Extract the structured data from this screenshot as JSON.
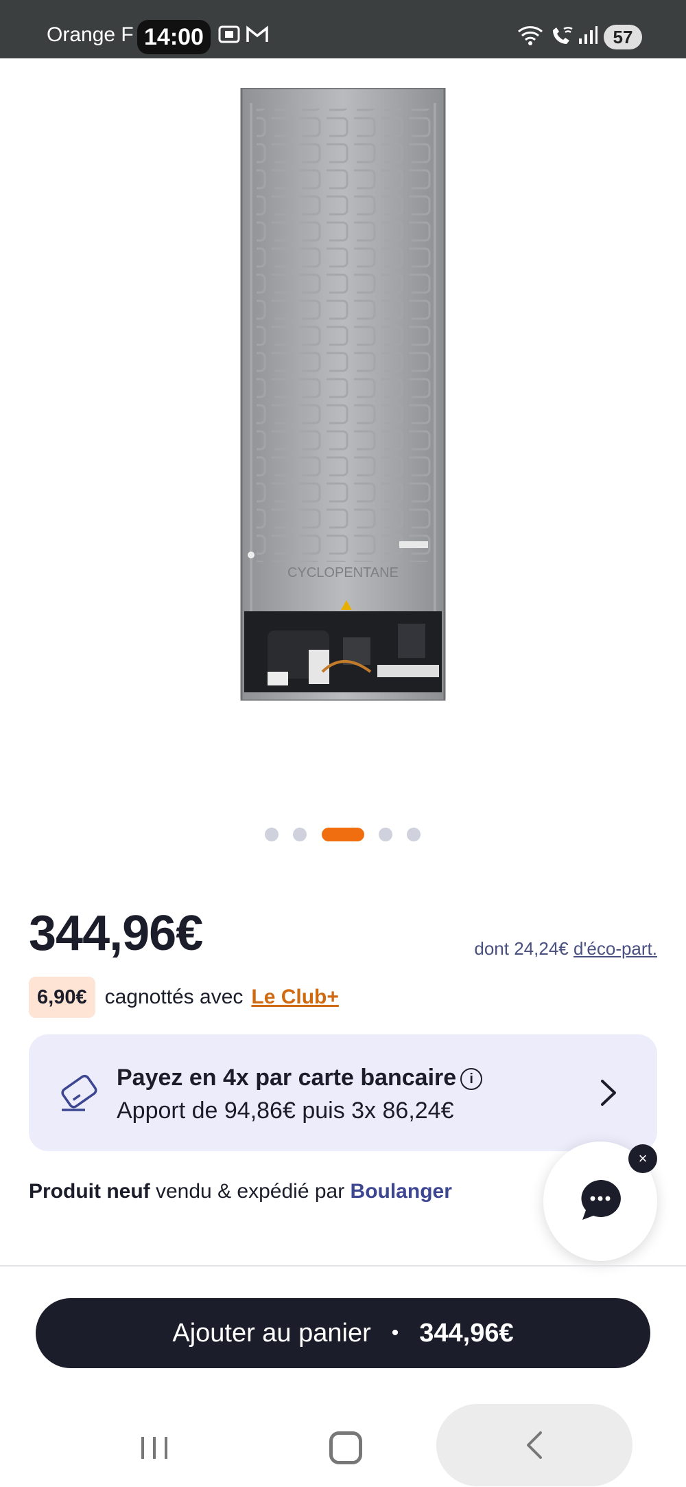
{
  "status_bar": {
    "carrier": "Orange F",
    "time": "14:00",
    "battery": "57"
  },
  "gallery": {
    "dots_count": 5,
    "active_index": 2
  },
  "product": {
    "price": "344,96€",
    "eco_prefix": "dont 24,24€ ",
    "eco_link": "d'éco-part."
  },
  "cashback": {
    "amount": "6,90€",
    "text": "cagnottés avec",
    "club_link": "Le Club+"
  },
  "payment": {
    "title": "Payez en 4x par carte bancaire",
    "info_glyph": "i",
    "detail": "Apport de 94,86€ puis 3x 86,24€"
  },
  "seller": {
    "condition": "Produit neuf",
    "text": " vendu & expédié par ",
    "brand": "Boulanger"
  },
  "chat": {
    "close_glyph": "×"
  },
  "cart_button": {
    "label": "Ajouter au panier",
    "separator": "•",
    "amount": "344,96€"
  },
  "colors": {
    "accent": "#f06e0f",
    "dark": "#1b1d2a",
    "payment_bg": "#ececfb",
    "cashback_bg": "#fde4d4"
  }
}
